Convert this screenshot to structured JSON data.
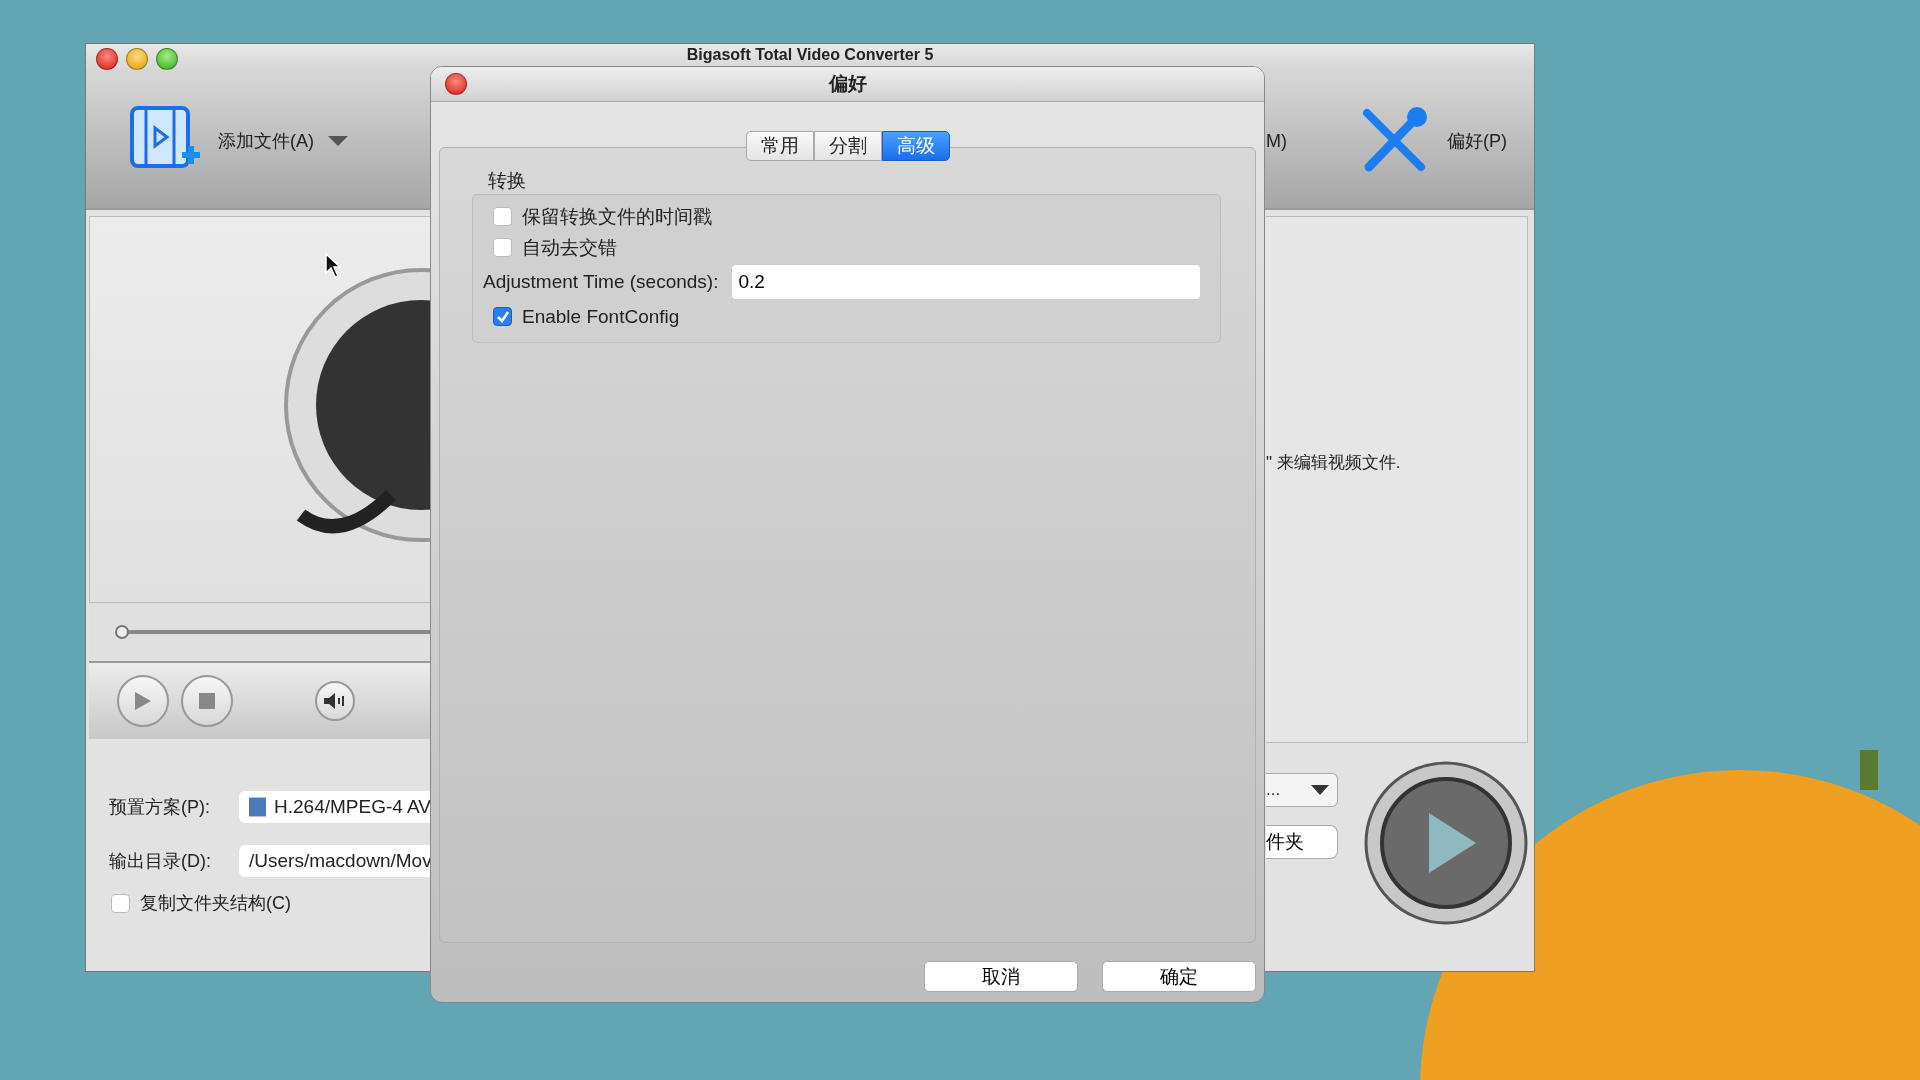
{
  "main_window": {
    "title": "Bigasoft Total Video Converter 5",
    "toolbar": [
      {
        "kind": "add",
        "label": "添加文件(A)"
      },
      {
        "kind": "partial",
        "label": "M)"
      },
      {
        "kind": "prefs",
        "label": "偏好(P)"
      }
    ],
    "seek": {
      "level": 0
    },
    "hint": "\" 来编辑视频文件.",
    "preset": {
      "label": "预置方案(P):",
      "value": "H.264/MPEG-4 AV"
    },
    "output": {
      "label": "输出目录(D):",
      "value": "/Users/macdown/Mov"
    },
    "copy_structure": {
      "label": "复制文件夹结构(C)",
      "checked": false
    },
    "dropdown": "...",
    "folder_button": "件夹"
  },
  "dialog": {
    "title": "偏好",
    "tabs": [
      {
        "label": "常用",
        "selected": false
      },
      {
        "label": "分割",
        "selected": false
      },
      {
        "label": "高级",
        "selected": true
      }
    ],
    "group": {
      "title": "转换",
      "rows": [
        {
          "kind": "checkbox",
          "label": "保留转换文件的时间戳",
          "checked": false
        },
        {
          "kind": "checkbox",
          "label": "自动去交错",
          "checked": false
        },
        {
          "kind": "field",
          "label": "Adjustment Time (seconds):",
          "value": "0.2"
        },
        {
          "kind": "checkbox",
          "label": "Enable FontConfig",
          "checked": true
        }
      ]
    },
    "buttons": [
      {
        "label": "取消"
      },
      {
        "label": "确定"
      }
    ]
  }
}
